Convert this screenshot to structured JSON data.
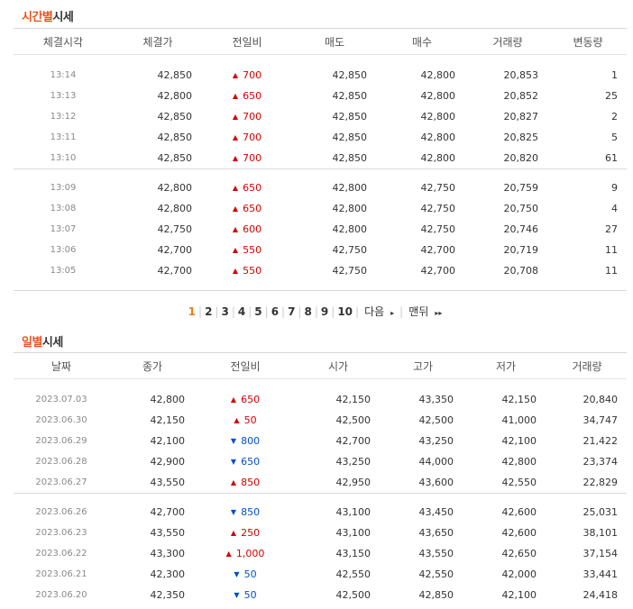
{
  "time_section": {
    "title_accent": "시간별",
    "title_rest": "시세",
    "headers": [
      "체결시각",
      "체결가",
      "전일비",
      "매도",
      "매수",
      "거래량",
      "변동량"
    ],
    "groups": [
      [
        {
          "time": "13:14",
          "price": "42,850",
          "dir": "up",
          "chg": "700",
          "ask": "42,850",
          "bid": "42,800",
          "vol": "20,853",
          "delta": "1"
        },
        {
          "time": "13:13",
          "price": "42,800",
          "dir": "up",
          "chg": "650",
          "ask": "42,850",
          "bid": "42,800",
          "vol": "20,852",
          "delta": "25"
        },
        {
          "time": "13:12",
          "price": "42,850",
          "dir": "up",
          "chg": "700",
          "ask": "42,850",
          "bid": "42,800",
          "vol": "20,827",
          "delta": "2"
        },
        {
          "time": "13:11",
          "price": "42,850",
          "dir": "up",
          "chg": "700",
          "ask": "42,850",
          "bid": "42,800",
          "vol": "20,825",
          "delta": "5"
        },
        {
          "time": "13:10",
          "price": "42,850",
          "dir": "up",
          "chg": "700",
          "ask": "42,850",
          "bid": "42,800",
          "vol": "20,820",
          "delta": "61"
        }
      ],
      [
        {
          "time": "13:09",
          "price": "42,800",
          "dir": "up",
          "chg": "650",
          "ask": "42,800",
          "bid": "42,750",
          "vol": "20,759",
          "delta": "9"
        },
        {
          "time": "13:08",
          "price": "42,800",
          "dir": "up",
          "chg": "650",
          "ask": "42,800",
          "bid": "42,750",
          "vol": "20,750",
          "delta": "4"
        },
        {
          "time": "13:07",
          "price": "42,750",
          "dir": "up",
          "chg": "600",
          "ask": "42,800",
          "bid": "42,750",
          "vol": "20,746",
          "delta": "27"
        },
        {
          "time": "13:06",
          "price": "42,700",
          "dir": "up",
          "chg": "550",
          "ask": "42,750",
          "bid": "42,700",
          "vol": "20,719",
          "delta": "11"
        },
        {
          "time": "13:05",
          "price": "42,700",
          "dir": "up",
          "chg": "550",
          "ask": "42,750",
          "bid": "42,700",
          "vol": "20,708",
          "delta": "11"
        }
      ]
    ]
  },
  "pagination": {
    "pages": [
      "1",
      "2",
      "3",
      "4",
      "5",
      "6",
      "7",
      "8",
      "9",
      "10"
    ],
    "current": "1",
    "next_label": "다음",
    "last_label": "맨뒤",
    "next_arrow": "▸",
    "last_arrow": "▸▸"
  },
  "day_section": {
    "title_accent": "일별",
    "title_rest": "시세",
    "headers": [
      "날짜",
      "종가",
      "전일비",
      "시가",
      "고가",
      "저가",
      "거래량"
    ],
    "groups": [
      [
        {
          "date": "2023.07.03",
          "close": "42,800",
          "dir": "up",
          "chg": "650",
          "open": "42,150",
          "high": "43,350",
          "low": "42,150",
          "vol": "20,840"
        },
        {
          "date": "2023.06.30",
          "close": "42,150",
          "dir": "up",
          "chg": "50",
          "open": "42,500",
          "high": "42,500",
          "low": "41,000",
          "vol": "34,747"
        },
        {
          "date": "2023.06.29",
          "close": "42,100",
          "dir": "down",
          "chg": "800",
          "open": "42,700",
          "high": "43,250",
          "low": "42,100",
          "vol": "21,422"
        },
        {
          "date": "2023.06.28",
          "close": "42,900",
          "dir": "down",
          "chg": "650",
          "open": "43,250",
          "high": "44,000",
          "low": "42,800",
          "vol": "23,374"
        },
        {
          "date": "2023.06.27",
          "close": "43,550",
          "dir": "up",
          "chg": "850",
          "open": "42,950",
          "high": "43,600",
          "low": "42,550",
          "vol": "22,829"
        }
      ],
      [
        {
          "date": "2023.06.26",
          "close": "42,700",
          "dir": "down",
          "chg": "850",
          "open": "43,100",
          "high": "43,450",
          "low": "42,600",
          "vol": "25,031"
        },
        {
          "date": "2023.06.23",
          "close": "43,550",
          "dir": "up",
          "chg": "250",
          "open": "43,100",
          "high": "43,650",
          "low": "42,600",
          "vol": "38,101"
        },
        {
          "date": "2023.06.22",
          "close": "43,300",
          "dir": "up",
          "chg": "1,000",
          "open": "43,150",
          "high": "43,550",
          "low": "42,650",
          "vol": "37,154"
        },
        {
          "date": "2023.06.21",
          "close": "42,300",
          "dir": "down",
          "chg": "50",
          "open": "42,550",
          "high": "42,550",
          "low": "42,000",
          "vol": "33,441"
        },
        {
          "date": "2023.06.20",
          "close": "42,350",
          "dir": "down",
          "chg": "50",
          "open": "42,500",
          "high": "42,850",
          "low": "42,100",
          "vol": "24,418"
        }
      ]
    ]
  },
  "icons": {
    "up": "▲",
    "down": "▼"
  },
  "colors": {
    "up": "#d60000",
    "down": "#0050c8",
    "accent": "#e8541e",
    "current_page": "#f07a14"
  }
}
